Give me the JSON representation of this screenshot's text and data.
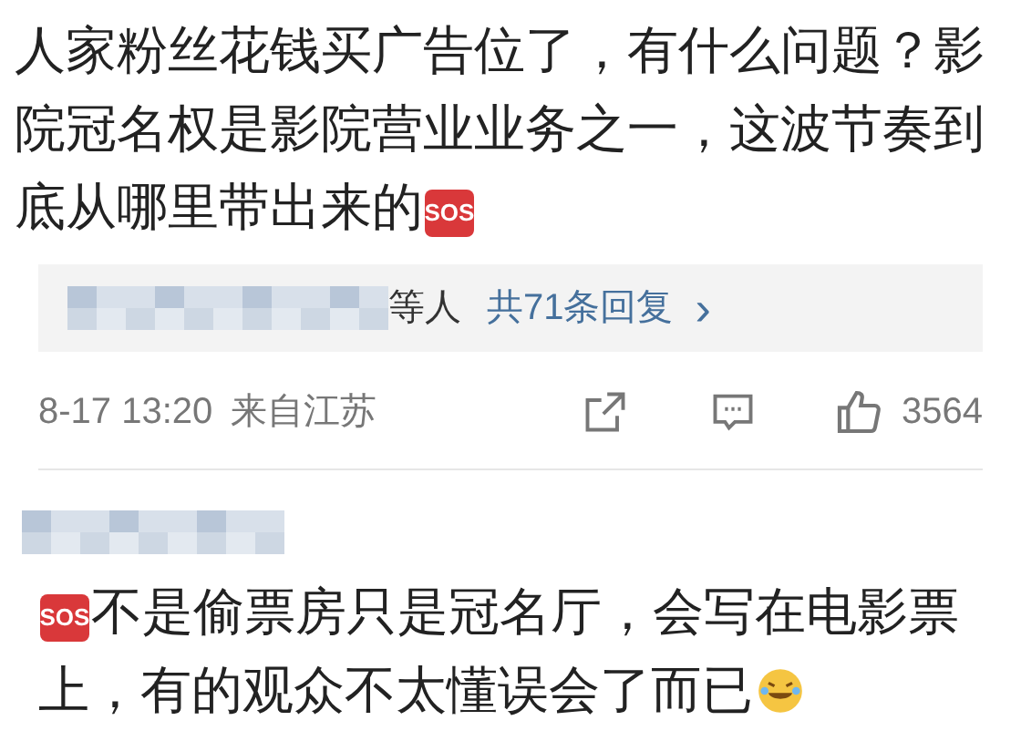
{
  "comments": [
    {
      "body": "人家粉丝花钱买广告位了，有什么问题？影院冠名权是影院营业业务之一，这波节奏到底从哪里带出来的",
      "emoji_after": "SOS",
      "replies": {
        "suffix": "等人",
        "link": "共71条回复",
        "chevron": "›"
      },
      "meta": {
        "time": "8-17 13:20",
        "location": "来自江苏",
        "likes": "3564"
      }
    },
    {
      "emoji_before": "SOS",
      "body": "不是偷票房只是冠名厅，会写在电影票上，有的观众不太懂误会了而已",
      "end_icon": {
        "kind": "laughing"
      }
    }
  ]
}
